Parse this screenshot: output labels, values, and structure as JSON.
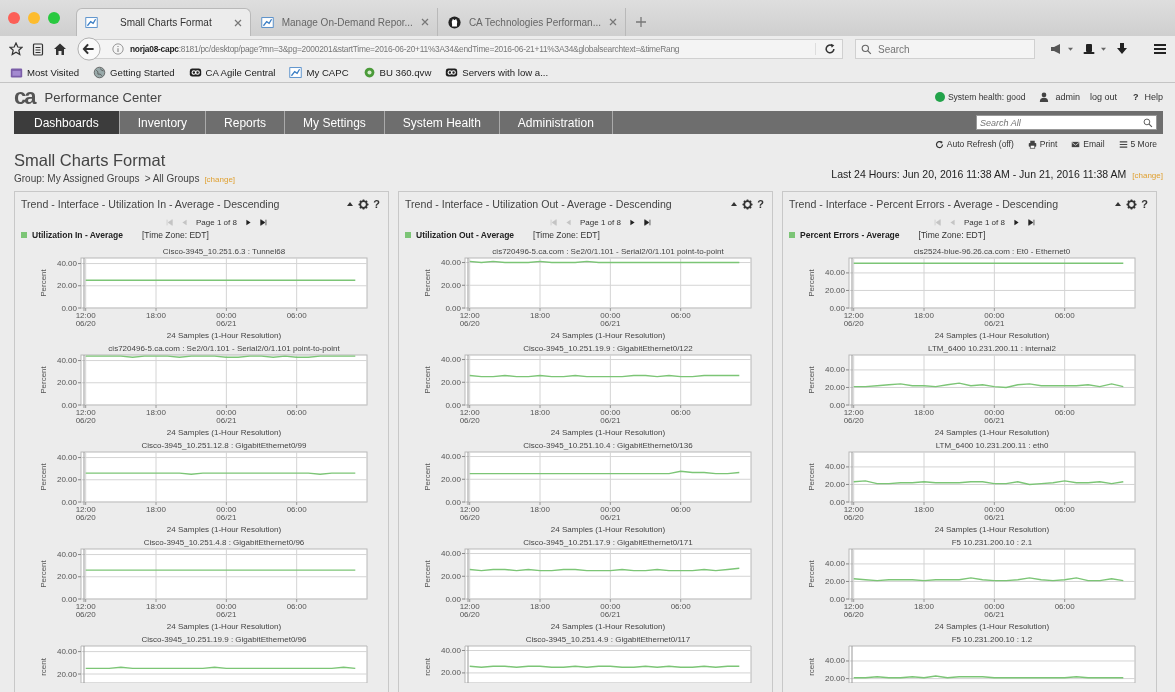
{
  "browser": {
    "tabs": [
      {
        "label": "Small Charts Format",
        "selected": true,
        "kind": "capc"
      },
      {
        "label": "Manage On-Demand Repor...",
        "selected": false,
        "kind": "capc"
      },
      {
        "label": "CA Technologies Performan...",
        "selected": false,
        "kind": "github"
      }
    ],
    "url_host": "norja08-capc",
    "url_path": ":8181/pc/desktop/page?mn=3&pg=2000201&startTime=2016-06-20+11%3A34&endTime=2016-06-21+11%3A34&globalsearchtext=&timeRang",
    "search_placeholder": "Search",
    "bookmarks": [
      {
        "label": "Most Visited",
        "kind": "folder"
      },
      {
        "label": "Getting Started",
        "kind": "globe"
      },
      {
        "label": "CA Agile Central",
        "kind": "ca"
      },
      {
        "label": "My CAPC",
        "kind": "capc"
      },
      {
        "label": "BU 360.qvw",
        "kind": "qlik"
      },
      {
        "label": "Servers with low a...",
        "kind": "ca"
      }
    ]
  },
  "app": {
    "logo": "ca",
    "product": "Performance Center",
    "health": {
      "label": "System health: good",
      "healthy": true
    },
    "user": "admin",
    "logout": "log out",
    "help": {
      "glyph": "?",
      "label": "Help"
    },
    "nav": [
      {
        "label": "Dashboards",
        "selected": true
      },
      {
        "label": "Inventory",
        "selected": false
      },
      {
        "label": "Reports",
        "selected": false
      },
      {
        "label": "My Settings",
        "selected": false
      },
      {
        "label": "System Health",
        "selected": false
      },
      {
        "label": "Administration",
        "selected": false
      }
    ],
    "search_placeholder": "Search All",
    "actions": [
      {
        "label": "Auto Refresh (off)",
        "kind": "refresh"
      },
      {
        "label": "Print",
        "kind": "print"
      },
      {
        "label": "Email",
        "kind": "email"
      },
      {
        "label": "5 More",
        "kind": "more"
      }
    ],
    "page_title": "Small Charts Format",
    "group": "Group: My Assigned Groups",
    "group_path": "> All Groups",
    "group_change": "[change]",
    "time_range": "Last 24 Hours: Jun 20, 2016 11:38 AM - Jun 21, 2016 11:38 AM",
    "time_change": "[change]"
  },
  "panels": [
    {
      "title": "Trend - Interface - Utilization In - Average - Descending",
      "help": "?",
      "pager": {
        "text": "Page 1 of 8",
        "prev_disabled": true,
        "next_disabled": false
      },
      "legend": "Utilization In - Average",
      "timezone": "[Time Zone: EDT]",
      "charts": [
        {
          "title": "Cisco-3945_10.251.6.3 : Tunnel68",
          "chart_data": {
            "type": "line",
            "grid": true,
            "xlabel": "24 Samples (1-Hour Resolution)",
            "ylabel": "Percent",
            "categories": [
              "12:00\n06/20",
              null,
              null,
              null,
              null,
              null,
              "18:00",
              null,
              null,
              null,
              null,
              null,
              "00:00\n06/21",
              null,
              null,
              null,
              null,
              null,
              "06:00",
              null,
              null,
              null,
              null,
              null
            ],
            "ylim": [
              0,
              45
            ],
            "yticks": [
              {
                "value": 0,
                "label": "0.00"
              },
              {
                "value": 20,
                "label": "20.00"
              },
              {
                "value": 40,
                "label": "40.00"
              }
            ],
            "series": [
              {
                "color": "#7cc576",
                "values": [
                  25,
                  25,
                  25,
                  25,
                  25,
                  25,
                  25,
                  25,
                  25,
                  25,
                  25,
                  25,
                  25,
                  25,
                  25,
                  25,
                  25,
                  25,
                  25,
                  25,
                  25,
                  25,
                  25,
                  25
                ]
              }
            ]
          }
        },
        {
          "title": "cis720496-5.ca.com : Se2/0/1.101 - Serial2/0/1.101 point-to-point",
          "chart_data": {
            "type": "line",
            "grid": true,
            "xlabel": "24 Samples (1-Hour Resolution)",
            "ylabel": "Percent",
            "categories": [
              "12:00\n06/20",
              null,
              null,
              null,
              null,
              null,
              "18:00",
              null,
              null,
              null,
              null,
              null,
              "00:00\n06/21",
              null,
              null,
              null,
              null,
              null,
              "06:00",
              null,
              null,
              null,
              null,
              null
            ],
            "ylim": [
              0,
              45
            ],
            "yticks": [
              {
                "value": 0,
                "label": "0.00"
              },
              {
                "value": 20,
                "label": "20.00"
              },
              {
                "value": 40,
                "label": "40.00"
              }
            ],
            "series": [
              {
                "color": "#7cc576",
                "values": [
                  44,
                  44,
                  44,
                  44,
                  43,
                  44,
                  44,
                  44,
                  43,
                  44,
                  44,
                  44,
                  43,
                  43,
                  44,
                  44,
                  43,
                  44,
                  43,
                  43,
                  44,
                  44,
                  44,
                  44
                ]
              }
            ]
          }
        },
        {
          "title": "Cisco-3945_10.251.12.8 : GigabitEthernet0/99",
          "chart_data": {
            "type": "line",
            "grid": true,
            "xlabel": "24 Samples (1-Hour Resolution)",
            "ylabel": "Percent",
            "categories": [
              "12:00\n06/20",
              null,
              null,
              null,
              null,
              null,
              "18:00",
              null,
              null,
              null,
              null,
              null,
              "00:00\n06/21",
              null,
              null,
              null,
              null,
              null,
              "06:00",
              null,
              null,
              null,
              null,
              null
            ],
            "ylim": [
              0,
              45
            ],
            "yticks": [
              {
                "value": 0,
                "label": "0.00"
              },
              {
                "value": 20,
                "label": "20.00"
              },
              {
                "value": 40,
                "label": "40.00"
              }
            ],
            "series": [
              {
                "color": "#7cc576",
                "values": [
                  26,
                  26,
                  26,
                  26,
                  26,
                  26,
                  26,
                  26,
                  26,
                  25,
                  26,
                  26,
                  26,
                  26,
                  26,
                  26,
                  26,
                  26,
                  26,
                  26,
                  25,
                  26,
                  26,
                  26
                ]
              }
            ]
          }
        },
        {
          "title": "Cisco-3945_10.251.4.8 : GigabitEthernet0/96",
          "chart_data": {
            "type": "line",
            "grid": true,
            "xlabel": "24 Samples (1-Hour Resolution)",
            "ylabel": "Percent",
            "categories": [
              "12:00\n06/20",
              null,
              null,
              null,
              null,
              null,
              "18:00",
              null,
              null,
              null,
              null,
              null,
              "00:00\n06/21",
              null,
              null,
              null,
              null,
              null,
              "06:00",
              null,
              null,
              null,
              null,
              null
            ],
            "ylim": [
              0,
              45
            ],
            "yticks": [
              {
                "value": 0,
                "label": "0.00"
              },
              {
                "value": 20,
                "label": "20.00"
              },
              {
                "value": 40,
                "label": "40.00"
              }
            ],
            "series": [
              {
                "color": "#7cc576",
                "values": [
                  26,
                  26,
                  26,
                  26,
                  26,
                  26,
                  26,
                  26,
                  26,
                  26,
                  26,
                  26,
                  26,
                  26,
                  26,
                  26,
                  26,
                  26,
                  26,
                  26,
                  26,
                  26,
                  26,
                  26
                ]
              }
            ]
          }
        },
        {
          "title": "Cisco-3945_10.251.19.9 : GigabitEthernet0/96",
          "chart_data": {
            "type": "line",
            "grid": true,
            "ylabel": "rcent",
            "categories": [
              null,
              null,
              null,
              null,
              null,
              null,
              null,
              null,
              null,
              null,
              null,
              null,
              null,
              null,
              null,
              null,
              null,
              null,
              null,
              null,
              null,
              null,
              null,
              null
            ],
            "ylim": [
              12,
              45
            ],
            "yticks": [
              {
                "value": 20,
                "label": "20.00"
              },
              {
                "value": 40,
                "label": "40.00"
              }
            ],
            "series": [
              {
                "color": "#7cc576",
                "values": [
                  25,
                  25,
                  25,
                  26,
                  25,
                  25,
                  25,
                  25,
                  25,
                  25,
                  25,
                  26,
                  25,
                  25,
                  25,
                  25,
                  25,
                  25,
                  25,
                  25,
                  25,
                  25,
                  26,
                  25
                ]
              }
            ]
          }
        }
      ]
    },
    {
      "title": "Trend - Interface - Utilization Out - Average - Descending",
      "help": "?",
      "pager": {
        "text": "Page 1 of 8",
        "prev_disabled": true,
        "next_disabled": false
      },
      "legend": "Utilization Out - Average",
      "timezone": "[Time Zone: EDT]",
      "charts": [
        {
          "title": "cis720496-5.ca.com : Se2/0/1.101 - Serial2/0/1.101 point-to-point",
          "chart_data": {
            "type": "line",
            "grid": true,
            "xlabel": "24 Samples (1-Hour Resolution)",
            "ylabel": "Percent",
            "categories": [
              "12:00\n06/20",
              null,
              null,
              null,
              null,
              null,
              "18:00",
              null,
              null,
              null,
              null,
              null,
              "00:00\n06/21",
              null,
              null,
              null,
              null,
              null,
              "06:00",
              null,
              null,
              null,
              null,
              null
            ],
            "ylim": [
              0,
              44
            ],
            "yticks": [
              {
                "value": 0,
                "label": "0.00"
              },
              {
                "value": 20,
                "label": "20.00"
              },
              {
                "value": 40,
                "label": "40.00"
              }
            ],
            "series": [
              {
                "color": "#7cc576",
                "values": [
                  41,
                  40,
                  41,
                  40,
                  40,
                  40,
                  41,
                  40,
                  40,
                  40,
                  41,
                  40,
                  40,
                  40,
                  40,
                  40,
                  40,
                  40,
                  40,
                  40,
                  40,
                  40,
                  40,
                  40
                ]
              }
            ]
          }
        },
        {
          "title": "Cisco-3945_10.251.19.9 : GigabitEthernet0/122",
          "chart_data": {
            "type": "line",
            "grid": true,
            "xlabel": "24 Samples (1-Hour Resolution)",
            "ylabel": "Percent",
            "categories": [
              "12:00\n06/20",
              null,
              null,
              null,
              null,
              null,
              "18:00",
              null,
              null,
              null,
              null,
              null,
              "00:00\n06/21",
              null,
              null,
              null,
              null,
              null,
              "06:00",
              null,
              null,
              null,
              null,
              null
            ],
            "ylim": [
              0,
              44
            ],
            "yticks": [
              {
                "value": 0,
                "label": "0.00"
              },
              {
                "value": 20,
                "label": "20.00"
              },
              {
                "value": 40,
                "label": "40.00"
              }
            ],
            "series": [
              {
                "color": "#7cc576",
                "values": [
                  26,
                  25,
                  25,
                  26,
                  25,
                  25,
                  26,
                  25,
                  25,
                  26,
                  25,
                  25,
                  25,
                  25,
                  26,
                  26,
                  25,
                  26,
                  25,
                  25,
                  26,
                  26,
                  26,
                  26
                ]
              }
            ]
          }
        },
        {
          "title": "Cisco-3945_10.251.10.4 : GigabitEthernet0/136",
          "chart_data": {
            "type": "line",
            "grid": true,
            "xlabel": "24 Samples (1-Hour Resolution)",
            "ylabel": "Percent",
            "categories": [
              "12:00\n06/20",
              null,
              null,
              null,
              null,
              null,
              "18:00",
              null,
              null,
              null,
              null,
              null,
              "00:00\n06/21",
              null,
              null,
              null,
              null,
              null,
              "06:00",
              null,
              null,
              null,
              null,
              null
            ],
            "ylim": [
              0,
              44
            ],
            "yticks": [
              {
                "value": 0,
                "label": "0.00"
              },
              {
                "value": 20,
                "label": "20.00"
              },
              {
                "value": 40,
                "label": "40.00"
              }
            ],
            "series": [
              {
                "color": "#7cc576",
                "values": [
                  25,
                  25,
                  25,
                  25,
                  25,
                  25,
                  25,
                  25,
                  25,
                  25,
                  25,
                  25,
                  25,
                  25,
                  25,
                  25,
                  25,
                  25,
                  27,
                  26,
                  26,
                  25,
                  25,
                  26
                ]
              }
            ]
          }
        },
        {
          "title": "Cisco-3945_10.251.17.9 : GigabitEthernet0/171",
          "chart_data": {
            "type": "line",
            "grid": true,
            "xlabel": "24 Samples (1-Hour Resolution)",
            "ylabel": "Percent",
            "categories": [
              "12:00\n06/20",
              null,
              null,
              null,
              null,
              null,
              "18:00",
              null,
              null,
              null,
              null,
              null,
              "00:00\n06/21",
              null,
              null,
              null,
              null,
              null,
              "06:00",
              null,
              null,
              null,
              null,
              null
            ],
            "ylim": [
              0,
              44
            ],
            "yticks": [
              {
                "value": 0,
                "label": "0.00"
              },
              {
                "value": 20,
                "label": "20.00"
              },
              {
                "value": 40,
                "label": "40.00"
              }
            ],
            "series": [
              {
                "color": "#7cc576",
                "values": [
                  26,
                  25,
                  26,
                  26,
                  25,
                  26,
                  25,
                  25,
                  26,
                  26,
                  25,
                  25,
                  25,
                  26,
                  25,
                  25,
                  26,
                  25,
                  25,
                  25,
                  26,
                  25,
                  26,
                  27
                ]
              }
            ]
          }
        },
        {
          "title": "Cisco-3945_10.251.4.9 : GigabitEthernet0/117",
          "chart_data": {
            "type": "line",
            "grid": true,
            "ylabel": "rcent",
            "categories": [
              null,
              null,
              null,
              null,
              null,
              null,
              null,
              null,
              null,
              null,
              null,
              null,
              null,
              null,
              null,
              null,
              null,
              null,
              null,
              null,
              null,
              null,
              null,
              null
            ],
            "ylim": [
              11,
              44
            ],
            "yticks": [
              {
                "value": 20,
                "label": "20.00"
              },
              {
                "value": 40,
                "label": "40.00"
              }
            ],
            "series": [
              {
                "color": "#7cc576",
                "values": [
                  26,
                  25,
                  26,
                  26,
                  25,
                  26,
                  26,
                  25,
                  25,
                  26,
                  25,
                  26,
                  26,
                  25,
                  25,
                  26,
                  25,
                  26,
                  25,
                  25,
                  26,
                  25,
                  26,
                  26
                ]
              }
            ]
          }
        }
      ]
    },
    {
      "title": "Trend - Interface - Percent Errors - Average - Descending",
      "help": "?",
      "pager": {
        "text": "Page 1 of 8",
        "prev_disabled": true,
        "next_disabled": false
      },
      "legend": "Percent Errors - Average",
      "timezone": "[Time Zone: EDT]",
      "charts": [
        {
          "title": "cis2524-blue-96.26.ca.com : Et0 - Ethernet0",
          "chart_data": {
            "type": "line",
            "grid": true,
            "xlabel": "24 Samples (1-Hour Resolution)",
            "ylabel": "Percent",
            "categories": [
              "12:00\n06/20",
              null,
              null,
              null,
              null,
              null,
              "18:00",
              null,
              null,
              null,
              null,
              null,
              "00:00\n06/21",
              null,
              null,
              null,
              null,
              null,
              "06:00",
              null,
              null,
              null,
              null,
              null
            ],
            "ylim": [
              0,
              57
            ],
            "yticks": [
              {
                "value": 0,
                "label": "0.00"
              },
              {
                "value": 20,
                "label": "20.00"
              },
              {
                "value": 40,
                "label": "40.00"
              }
            ],
            "series": [
              {
                "color": "#7cc576",
                "values": [
                  51,
                  51,
                  51,
                  51,
                  51,
                  51,
                  51,
                  51,
                  51,
                  51,
                  51,
                  51,
                  51,
                  51,
                  51,
                  51,
                  51,
                  51,
                  51,
                  51,
                  51,
                  51,
                  51,
                  51
                ]
              }
            ]
          }
        },
        {
          "title": "LTM_6400 10.231.200.11 : internal2",
          "chart_data": {
            "type": "line",
            "grid": true,
            "xlabel": "24 Samples (1-Hour Resolution)",
            "ylabel": "Percent",
            "categories": [
              "12:00\n06/20",
              null,
              null,
              null,
              null,
              null,
              "18:00",
              null,
              null,
              null,
              null,
              null,
              "00:00\n06/21",
              null,
              null,
              null,
              null,
              null,
              "06:00",
              null,
              null,
              null,
              null,
              null
            ],
            "ylim": [
              0,
              57
            ],
            "yticks": [
              {
                "value": 0,
                "label": "0.00"
              },
              {
                "value": 20,
                "label": "20.00"
              },
              {
                "value": 40,
                "label": "40.00"
              }
            ],
            "series": [
              {
                "color": "#7cc576",
                "values": [
                  21,
                  21,
                  22,
                  23,
                  24,
                  22,
                  22,
                  21,
                  23,
                  25,
                  22,
                  23,
                  21,
                  20,
                  23,
                  24,
                  22,
                  22,
                  22,
                  22,
                  23,
                  21,
                  24,
                  21
                ]
              }
            ]
          }
        },
        {
          "title": "LTM_6400 10.231.200.11 : eth0",
          "chart_data": {
            "type": "line",
            "grid": true,
            "xlabel": "24 Samples (1-Hour Resolution)",
            "ylabel": "Percent",
            "categories": [
              "12:00\n06/20",
              null,
              null,
              null,
              null,
              null,
              "18:00",
              null,
              null,
              null,
              null,
              null,
              "00:00\n06/21",
              null,
              null,
              null,
              null,
              null,
              "06:00",
              null,
              null,
              null,
              null,
              null
            ],
            "ylim": [
              0,
              57
            ],
            "yticks": [
              {
                "value": 0,
                "label": "0.00"
              },
              {
                "value": 20,
                "label": "20.00"
              },
              {
                "value": 40,
                "label": "40.00"
              }
            ],
            "series": [
              {
                "color": "#7cc576",
                "values": [
                  23,
                  24,
                  21,
                  21,
                  22,
                  22,
                  23,
                  22,
                  22,
                  22,
                  23,
                  23,
                  21,
                  21,
                  23,
                  20,
                  21,
                  22,
                  24,
                  22,
                  22,
                  23,
                  21,
                  23
                ]
              }
            ]
          }
        },
        {
          "title": "F5 10.231.200.10 : 2.1",
          "chart_data": {
            "type": "line",
            "grid": true,
            "xlabel": "24 Samples (1-Hour Resolution)",
            "ylabel": "Percent",
            "categories": [
              "12:00\n06/20",
              null,
              null,
              null,
              null,
              null,
              "18:00",
              null,
              null,
              null,
              null,
              null,
              "00:00\n06/21",
              null,
              null,
              null,
              null,
              null,
              "06:00",
              null,
              null,
              null,
              null,
              null
            ],
            "ylim": [
              0,
              57
            ],
            "yticks": [
              {
                "value": 0,
                "label": "0.00"
              },
              {
                "value": 20,
                "label": "20.00"
              },
              {
                "value": 40,
                "label": "40.00"
              }
            ],
            "series": [
              {
                "color": "#7cc576",
                "values": [
                  23,
                  22,
                  21,
                  22,
                  22,
                  22,
                  21,
                  22,
                  22,
                  22,
                  24,
                  22,
                  21,
                  21,
                  22,
                  24,
                  22,
                  21,
                  22,
                  24,
                  21,
                  21,
                  23,
                  21
                ]
              }
            ]
          }
        },
        {
          "title": "F5 10.231.200.10 : 1.2",
          "chart_data": {
            "type": "line",
            "grid": true,
            "ylabel": "rcent",
            "categories": [
              null,
              null,
              null,
              null,
              null,
              null,
              null,
              null,
              null,
              null,
              null,
              null,
              null,
              null,
              null,
              null,
              null,
              null,
              null,
              null,
              null,
              null,
              null,
              null
            ],
            "ylim": [
              15,
              57
            ],
            "yticks": [
              {
                "value": 20,
                "label": "20.00"
              },
              {
                "value": 40,
                "label": "40.00"
              }
            ],
            "series": [
              {
                "color": "#7cc576",
                "values": [
                  21,
                  21,
                  22,
                  21,
                  21,
                  22,
                  21,
                  23,
                  21,
                  22,
                  22,
                  22,
                  21,
                  21,
                  21,
                  21,
                  21,
                  21,
                  21,
                  22,
                  21,
                  21,
                  21,
                  21
                ]
              }
            ]
          }
        }
      ]
    }
  ]
}
